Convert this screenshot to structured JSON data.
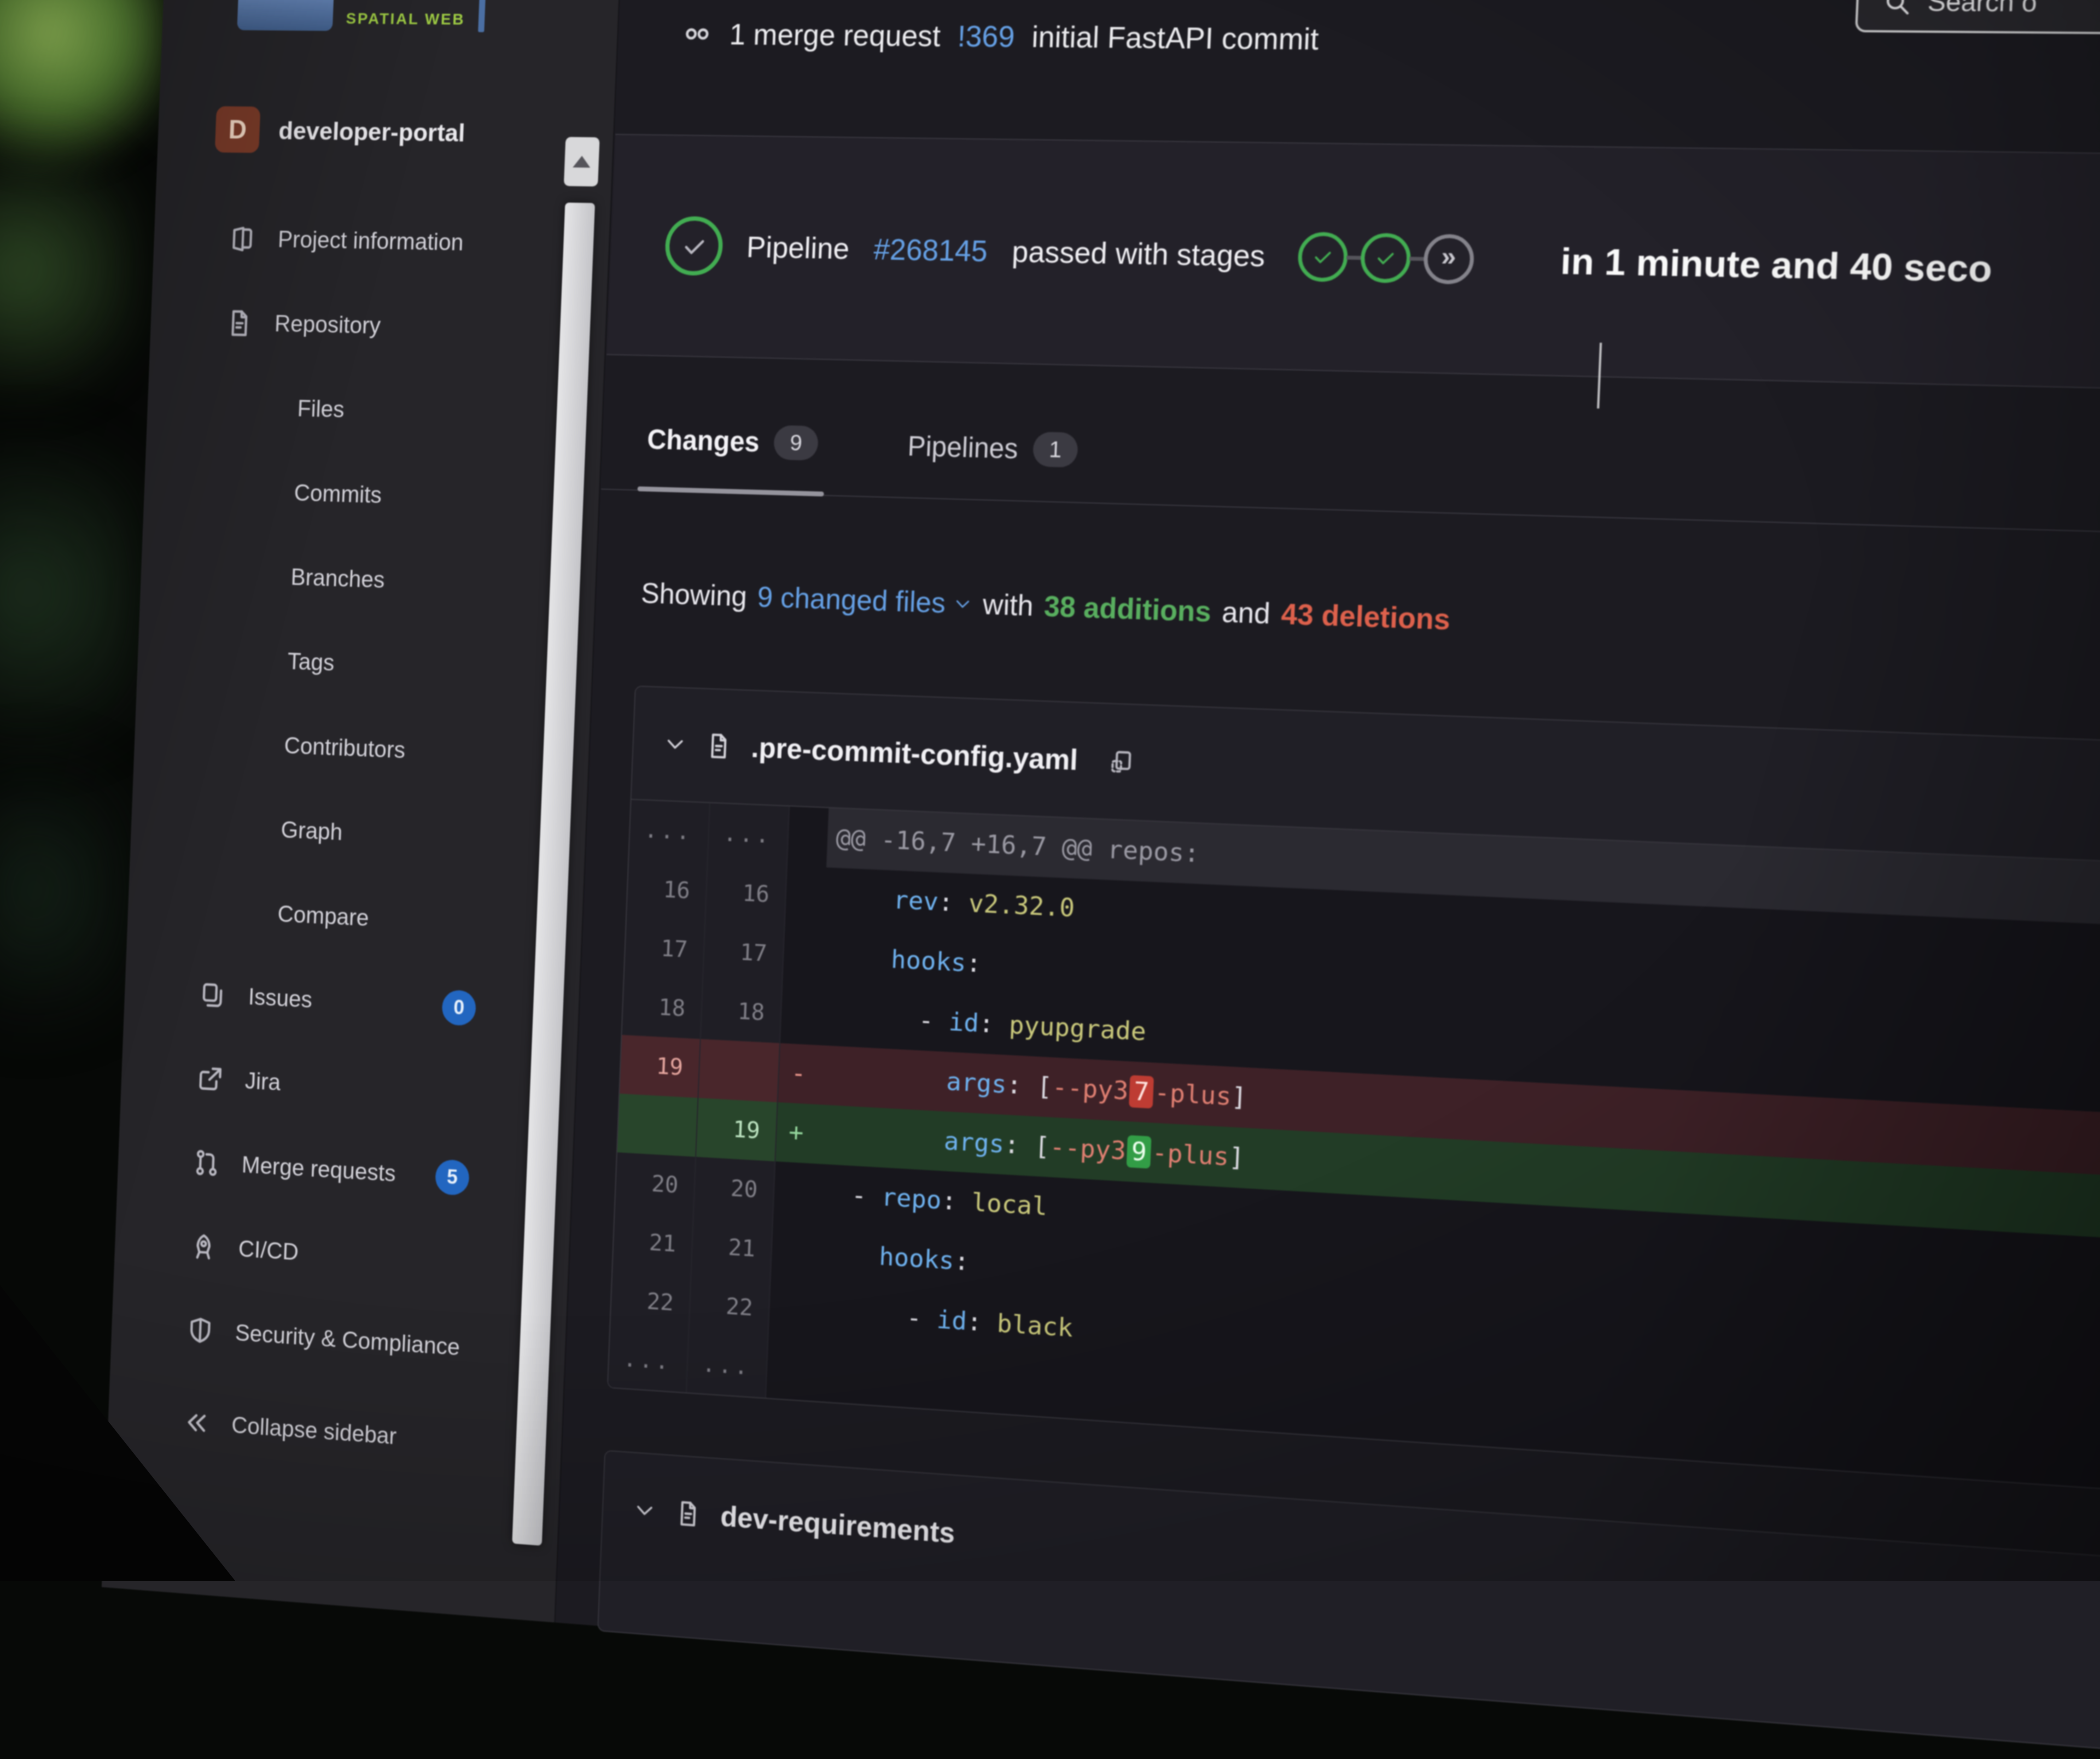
{
  "background": {
    "logo_text": "SPATIAL WEB"
  },
  "search": {
    "visible_text": "Search o",
    "icon": "search-icon"
  },
  "sidebar": {
    "project": {
      "avatar_letter": "D",
      "name": "developer-portal"
    },
    "items": [
      {
        "label": "Project information",
        "icon": "book-icon"
      },
      {
        "label": "Repository",
        "icon": "doc-icon"
      },
      {
        "label": "Files",
        "indent": true
      },
      {
        "label": "Commits",
        "indent": true
      },
      {
        "label": "Branches",
        "indent": true
      },
      {
        "label": "Tags",
        "indent": true
      },
      {
        "label": "Contributors",
        "indent": true
      },
      {
        "label": "Graph",
        "indent": true
      },
      {
        "label": "Compare",
        "indent": true
      },
      {
        "label": "Issues",
        "icon": "issues-icon",
        "badge": "0"
      },
      {
        "label": "Jira",
        "icon": "external-link-icon"
      },
      {
        "label": "Merge requests",
        "icon": "merge-request-icon",
        "badge": "5"
      },
      {
        "label": "CI/CD",
        "icon": "rocket-icon"
      },
      {
        "label": "Security & Compliance",
        "icon": "shield-icon"
      }
    ],
    "collapse": {
      "label": "Collapse sidebar",
      "icon": "double-chevron-left-icon"
    }
  },
  "topbar": {
    "icon": "commits-icon",
    "mr_count_text": "1 merge request",
    "mr_ref": "!369",
    "mr_title": "initial FastAPI commit"
  },
  "pipeline": {
    "status_icon": "check-circle-icon",
    "label": "Pipeline",
    "number": "#268145",
    "status_text": "passed with stages",
    "duration_text": "in 1 minute and 40 seco",
    "stages": [
      {
        "status": "passed"
      },
      {
        "status": "passed"
      },
      {
        "status": "skipped"
      }
    ]
  },
  "tabs": [
    {
      "label": "Changes",
      "badge": "9",
      "active": true
    },
    {
      "label": "Pipelines",
      "badge": "1",
      "active": false
    }
  ],
  "summary": {
    "prefix": "Showing",
    "files_link": "9 changed files",
    "middle": "with",
    "additions": "38 additions",
    "conjunction": "and",
    "deletions": "43 deletions"
  },
  "colors": {
    "accent_blue": "#63a0e8",
    "badge_blue": "#2066c4",
    "additions_green": "#56b05d",
    "deletions_red": "#e2604a",
    "pipeline_passed_green": "#3fae4f",
    "avatar_rust": "#7c3a28",
    "logo_green": "#9ccb3f"
  },
  "diff": {
    "files": [
      {
        "name": ".pre-commit-config.yaml"
      },
      {
        "name": "dev-requirements"
      }
    ],
    "rows": [
      {
        "old": "...",
        "new": "...",
        "kind": "hunk",
        "marker": "",
        "tokens": [
          [
            "@@ -16,7 +16,7 @@ repos:",
            "h"
          ]
        ]
      },
      {
        "old": "16",
        "new": "16",
        "kind": "ctx",
        "marker": "",
        "tokens": [
          [
            "    ",
            "p"
          ],
          [
            "rev",
            "k"
          ],
          [
            ": ",
            "p"
          ],
          [
            "v2.32.0",
            "v"
          ]
        ]
      },
      {
        "old": "17",
        "new": "17",
        "kind": "ctx",
        "marker": "",
        "tokens": [
          [
            "    ",
            "p"
          ],
          [
            "hooks",
            "k"
          ],
          [
            ":",
            "p"
          ]
        ]
      },
      {
        "old": "18",
        "new": "18",
        "kind": "ctx",
        "marker": "",
        "tokens": [
          [
            "      - ",
            "p"
          ],
          [
            "id",
            "k"
          ],
          [
            ": ",
            "p"
          ],
          [
            "pyupgrade",
            "v"
          ]
        ]
      },
      {
        "old": "19",
        "new": "",
        "kind": "del",
        "marker": "-",
        "tokens": [
          [
            "        ",
            "p"
          ],
          [
            "args",
            "k"
          ],
          [
            ": ",
            "p"
          ],
          [
            "[",
            "p"
          ],
          [
            "--py3",
            "s"
          ],
          [
            "7",
            "wd"
          ],
          [
            "-plus",
            "s"
          ],
          [
            "]",
            "p"
          ]
        ]
      },
      {
        "old": "",
        "new": "19",
        "kind": "add",
        "marker": "+",
        "tokens": [
          [
            "        ",
            "p"
          ],
          [
            "args",
            "k"
          ],
          [
            ": ",
            "p"
          ],
          [
            "[",
            "p"
          ],
          [
            "--py3",
            "s"
          ],
          [
            "9",
            "wa"
          ],
          [
            "-plus",
            "s"
          ],
          [
            "]",
            "p"
          ]
        ]
      },
      {
        "old": "20",
        "new": "20",
        "kind": "ctx",
        "marker": "",
        "tokens": [
          [
            "  - ",
            "p"
          ],
          [
            "repo",
            "k"
          ],
          [
            ": ",
            "p"
          ],
          [
            "local",
            "v"
          ]
        ]
      },
      {
        "old": "21",
        "new": "21",
        "kind": "ctx",
        "marker": "",
        "tokens": [
          [
            "    ",
            "p"
          ],
          [
            "hooks",
            "k"
          ],
          [
            ":",
            "p"
          ]
        ]
      },
      {
        "old": "22",
        "new": "22",
        "kind": "ctx",
        "marker": "",
        "tokens": [
          [
            "      - ",
            "p"
          ],
          [
            "id",
            "k"
          ],
          [
            ": ",
            "p"
          ],
          [
            "black",
            "v"
          ]
        ]
      },
      {
        "old": "...",
        "new": "...",
        "kind": "expander",
        "marker": "",
        "tokens": []
      }
    ]
  }
}
